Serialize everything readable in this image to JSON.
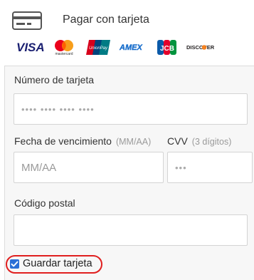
{
  "header": {
    "title": "Pagar con tarjeta",
    "icon": "credit-card-icon",
    "brands": [
      {
        "name": "VISA",
        "color": "#1a1f71"
      },
      {
        "name": "mastercard",
        "color": "#eb001b"
      },
      {
        "name": "UnionPay",
        "color": "#d7001b"
      },
      {
        "name": "AMEX",
        "color": "#1f72cd"
      },
      {
        "name": "JCB",
        "color": "#0b5aa9"
      },
      {
        "name": "DISCOVER",
        "color": "#f58220"
      }
    ]
  },
  "form": {
    "card_number": {
      "label": "Número de tarjeta",
      "placeholder": "•••• •••• •••• ••••"
    },
    "expiry": {
      "label": "Fecha de vencimiento",
      "hint": "(MM/AA)",
      "placeholder": "MM/AA"
    },
    "cvv": {
      "label": "CVV",
      "hint": "(3 dígitos)",
      "placeholder": "•••"
    },
    "postal": {
      "label": "Código postal",
      "placeholder": ""
    },
    "save_card": {
      "label": "Guardar tarjeta",
      "checked": true
    }
  },
  "colors": {
    "highlight": "#e01f1f",
    "checkbox": "#2b6fd6"
  }
}
